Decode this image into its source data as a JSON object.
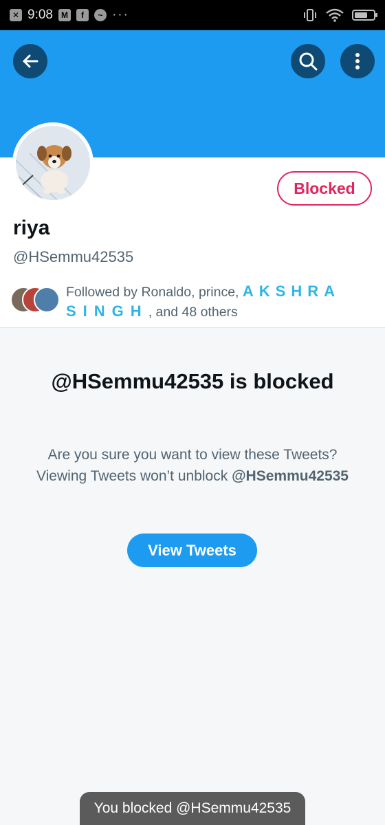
{
  "status_bar": {
    "time": "9:08",
    "more": "···"
  },
  "profile": {
    "name": "riya",
    "handle": "@HSemmu42535",
    "blocked_label": "Blocked",
    "followed_by_prefix": "Followed by Ronaldo, prince, ",
    "followed_by_stylized_1": "AKSHRA",
    "followed_by_stylized_2": "SINGH",
    "followed_by_suffix": ", and 48 others"
  },
  "blocked_notice": {
    "title": "@HSemmu42535 is blocked",
    "description": "Are you sure you want to view these Tweets? Viewing Tweets won’t unblock ",
    "description_handle": "@HSemmu42535",
    "view_button": "View Tweets"
  },
  "toast": {
    "message": "You blocked @HSemmu42535"
  },
  "colors": {
    "accent": "#1d9bf0",
    "blocked_red": "#e0245e",
    "banner": "#1d9bf0",
    "toast_bg": "#5b5b5b"
  },
  "icons": {
    "back": "arrow-left-icon",
    "search": "search-icon",
    "more": "more-vertical-icon"
  }
}
